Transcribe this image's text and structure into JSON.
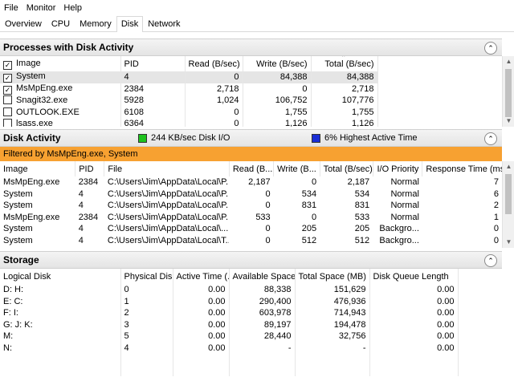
{
  "menu": [
    "File",
    "Monitor",
    "Help"
  ],
  "tabs": [
    {
      "label": "Overview",
      "active": false
    },
    {
      "label": "CPU",
      "active": false
    },
    {
      "label": "Memory",
      "active": false
    },
    {
      "label": "Disk",
      "active": true
    },
    {
      "label": "Network",
      "active": false
    }
  ],
  "processes": {
    "title": "Processes with Disk Activity",
    "collapse_glyph": "⌃",
    "headers": {
      "image": "Image",
      "pid": "PID",
      "read": "Read (B/sec)",
      "write": "Write (B/sec)",
      "total": "Total (B/sec)"
    },
    "rows": [
      {
        "checked": true,
        "selected": true,
        "image": "System",
        "pid": "4",
        "read": "0",
        "write": "84,388",
        "total": "84,388"
      },
      {
        "checked": true,
        "selected": false,
        "image": "MsMpEng.exe",
        "pid": "2384",
        "read": "2,718",
        "write": "0",
        "total": "2,718"
      },
      {
        "checked": false,
        "selected": false,
        "image": "Snagit32.exe",
        "pid": "5928",
        "read": "1,024",
        "write": "106,752",
        "total": "107,776"
      },
      {
        "checked": false,
        "selected": false,
        "image": "OUTLOOK.EXE",
        "pid": "6108",
        "read": "0",
        "write": "1,755",
        "total": "1,755"
      },
      {
        "checked": false,
        "selected": false,
        "image": "lsass.exe",
        "pid": "6364",
        "read": "0",
        "write": "1,126",
        "total": "1,126"
      }
    ]
  },
  "disk_activity": {
    "title": "Disk Activity",
    "io_label": "244 KB/sec Disk I/O",
    "io_color": "#1ec21e",
    "active_label": "6% Highest Active Time",
    "active_color": "#1a2ed6",
    "filter_text": "Filtered by MsMpEng.exe, System",
    "filter_color": "#f7a131",
    "headers": {
      "image": "Image",
      "pid": "PID",
      "file": "File",
      "read": "Read (B...",
      "write": "Write (B...",
      "total": "Total (B/sec)",
      "priority": "I/O Priority",
      "response": "Response Time (ms)"
    },
    "rows": [
      {
        "image": "MsMpEng.exe",
        "pid": "2384",
        "file": "C:\\Users\\Jim\\AppData\\Local\\P...",
        "read": "2,187",
        "write": "0",
        "total": "2,187",
        "priority": "Normal",
        "response": "7"
      },
      {
        "image": "System",
        "pid": "4",
        "file": "C:\\Users\\Jim\\AppData\\Local\\P...",
        "read": "0",
        "write": "534",
        "total": "534",
        "priority": "Normal",
        "response": "6"
      },
      {
        "image": "System",
        "pid": "4",
        "file": "C:\\Users\\Jim\\AppData\\Local\\P...",
        "read": "0",
        "write": "831",
        "total": "831",
        "priority": "Normal",
        "response": "2"
      },
      {
        "image": "MsMpEng.exe",
        "pid": "2384",
        "file": "C:\\Users\\Jim\\AppData\\Local\\P...",
        "read": "533",
        "write": "0",
        "total": "533",
        "priority": "Normal",
        "response": "1"
      },
      {
        "image": "System",
        "pid": "4",
        "file": "C:\\Users\\Jim\\AppData\\Local\\...",
        "read": "0",
        "write": "205",
        "total": "205",
        "priority": "Backgro...",
        "response": "0"
      },
      {
        "image": "System",
        "pid": "4",
        "file": "C:\\Users\\Jim\\AppData\\Local\\T...",
        "read": "0",
        "write": "512",
        "total": "512",
        "priority": "Backgro...",
        "response": "0"
      }
    ]
  },
  "storage": {
    "title": "Storage",
    "headers": {
      "logical": "Logical Disk",
      "physical": "Physical Disk",
      "active": "Active Time (...",
      "available": "Available Space...",
      "total": "Total Space (MB)",
      "queue": "Disk Queue Length"
    },
    "rows": [
      {
        "logical": "D: H:",
        "physical": "0",
        "active": "0.00",
        "available": "88,338",
        "total": "151,629",
        "queue": "0.00"
      },
      {
        "logical": "E: C:",
        "physical": "1",
        "active": "0.00",
        "available": "290,400",
        "total": "476,936",
        "queue": "0.00"
      },
      {
        "logical": "F: I:",
        "physical": "2",
        "active": "0.00",
        "available": "603,978",
        "total": "714,943",
        "queue": "0.00"
      },
      {
        "logical": "G: J: K:",
        "physical": "3",
        "active": "0.00",
        "available": "89,197",
        "total": "194,478",
        "queue": "0.00"
      },
      {
        "logical": "M:",
        "physical": "5",
        "active": "0.00",
        "available": "28,440",
        "total": "32,756",
        "queue": "0.00"
      },
      {
        "logical": "N:",
        "physical": "4",
        "active": "0.00",
        "available": "-",
        "total": "-",
        "queue": "0.00"
      }
    ]
  }
}
